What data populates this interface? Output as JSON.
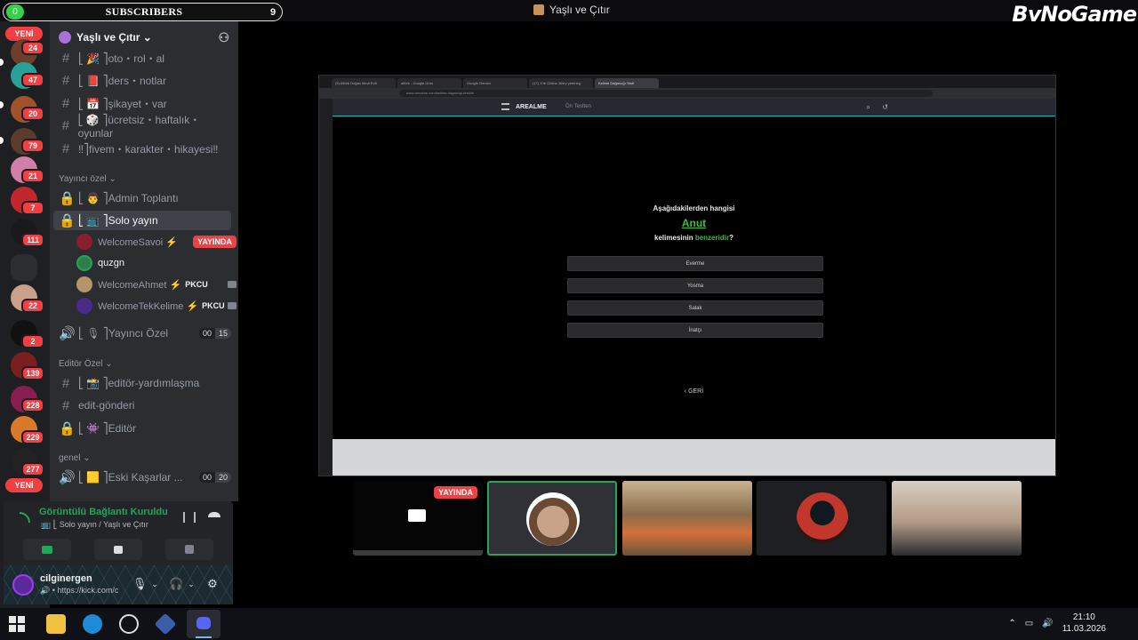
{
  "titlebar": {
    "subscribers_label": "SUBSCRIBERS",
    "subscribers_count": "9",
    "subscribers_left": "0",
    "window_title": "Yaşlı ve Çıtır",
    "brand": "ByNoGame"
  },
  "rail": {
    "yeni_label": "YENİ",
    "badges": [
      "24",
      "47",
      "20",
      "79",
      "21",
      "7",
      "111",
      "22",
      "2",
      "139",
      "228",
      "229",
      "277"
    ]
  },
  "server": {
    "name": "Yaşlı ve Çıtır ⌄",
    "channels": [
      {
        "name": "⎣ 🎉 ⎤oto・rol・al"
      },
      {
        "name": "⎣ 📕 ⎤ders・notlar"
      },
      {
        "name": "⎣ 📅 ⎤şikayet・var"
      },
      {
        "name": "⎣ 🎲 ⎤ücretsiz・haftalık・oyunlar"
      },
      {
        "name": "‼⎤fivem・karakter・hikayesi‼"
      }
    ],
    "cat_yayinci": "Yayıncı özel ⌄",
    "ch_admin": "⎣ 👨 ⎤Admin Toplantı",
    "ch_solo": "⎣ 📺 ⎤Solo yayın",
    "users": [
      {
        "name": "WelcomeSavoi ⚡",
        "tag": "YAYINDA"
      },
      {
        "name": "quzgn"
      },
      {
        "name": "WelcomeAhmet ⚡",
        "tag": "PKCU"
      },
      {
        "name": "WelcomeTekKelime ⚡",
        "tag": "PKCU"
      }
    ],
    "ch_yayinci_ozel": "⎣ 🎙 ⎤Yayıncı Özel",
    "ch_yayinci_ozel_counts": [
      "00",
      "15"
    ],
    "cat_editor": "Editör Özel ⌄",
    "ch_editor_yardim": "⎣ 📸 ⎤editör-yardımlaşma",
    "ch_edit_gonderi": "edit-gönderi",
    "ch_editor": "⎣ 👾 ⎤Editör",
    "cat_genel": "genel ⌄",
    "ch_eski": "⎣ 🟨 ⎤Eski Kaşarlar ...",
    "ch_eski_counts": [
      "00",
      "20"
    ]
  },
  "voice": {
    "status": "Görüntülü Bağlantı Kuruldu",
    "location": "📺 ⎣ Solo yayın / Yaşlı ve Çıtır"
  },
  "user": {
    "name": "cilginergen",
    "status": "🔊 • https://kick.com/c"
  },
  "browser": {
    "tabs": [
      "(5) Alfürk Doğan Medi Edit",
      "alfürk - Google Ürün",
      "Google Gemini",
      "(17) X'te Gökhz 'Ahiry yeteneg",
      "Kelime Dağarcığı Testi"
    ],
    "url": "www.arealme.com/kelime-dagarcigi-testi/tr/",
    "site_logo": "AREALME",
    "crumb": "Ön Testten",
    "question_pre": "Aşağıdakilerden hangisi",
    "word": "Anut",
    "question_mid": "kelimesinin ",
    "question_highlight": "benzeridir",
    "question_end": "?",
    "options": [
      "Everme",
      "Yosma",
      "Salak",
      "İnatçı"
    ],
    "back": "‹ GERİ"
  },
  "tiles": {
    "live_label": "YAYINDA"
  },
  "taskbar": {
    "time": "21:10",
    "date": "11.03.2026"
  }
}
